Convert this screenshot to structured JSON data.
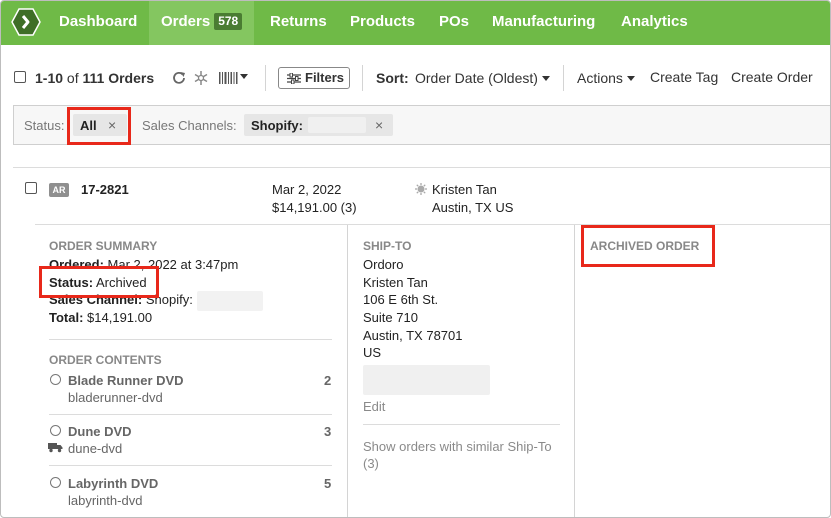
{
  "nav": {
    "items": [
      {
        "label": "Dashboard"
      },
      {
        "label": "Orders",
        "count": "578"
      },
      {
        "label": "Returns"
      },
      {
        "label": "Products"
      },
      {
        "label": "POs"
      },
      {
        "label": "Manufacturing"
      },
      {
        "label": "Analytics"
      }
    ]
  },
  "toolbar": {
    "range": "1-10",
    "of": "of",
    "total": "111 Orders",
    "filters_label": "Filters",
    "sort_label": "Sort:",
    "sort_value": "Order Date (Oldest)",
    "actions_label": "Actions",
    "create_tag": "Create Tag",
    "create_order": "Create Order"
  },
  "filters": {
    "status_label": "Status:",
    "status_value": "All",
    "channels_label": "Sales Channels:",
    "channel_value": "Shopify:",
    "remove_glyph": "×"
  },
  "order": {
    "badge": "AR",
    "number": "17-2821",
    "date": "Mar 2, 2022",
    "amount": "$14,191.00 (3)",
    "customer_name": "Kristen Tan",
    "customer_location": "Austin, TX US",
    "summary": {
      "heading": "ORDER SUMMARY",
      "ordered_label": "Ordered:",
      "ordered_value": "Mar 2, 2022 at 3:47pm",
      "status_label": "Status:",
      "status_value": "Archived",
      "channel_label": "Sales Channel:",
      "channel_value": "Shopify:",
      "total_label": "Total:",
      "total_value": "$14,191.00"
    },
    "contents": {
      "heading": "ORDER CONTENTS",
      "items": [
        {
          "name": "Blade Runner DVD",
          "sku": "bladerunner-dvd",
          "qty": "2"
        },
        {
          "name": "Dune DVD",
          "sku": "dune-dvd",
          "qty": "3"
        },
        {
          "name": "Labyrinth DVD",
          "sku": "labyrinth-dvd",
          "qty": "5"
        }
      ]
    },
    "ship_to": {
      "heading": "SHIP-TO",
      "lines": [
        "Ordoro",
        "Kristen Tan",
        "106 E 6th St.",
        "Suite 710",
        "Austin, TX 78701",
        "US"
      ],
      "edit_label": "Edit",
      "similar_line1": "Show orders with similar Ship-To",
      "similar_line2": "(3)"
    },
    "archived_heading": "ARCHIVED ORDER"
  },
  "colors": {
    "nav_bg": "#6fba47",
    "nav_active": "#84c660",
    "badge_bg": "#4a7c32",
    "highlight": "#e8281a"
  }
}
